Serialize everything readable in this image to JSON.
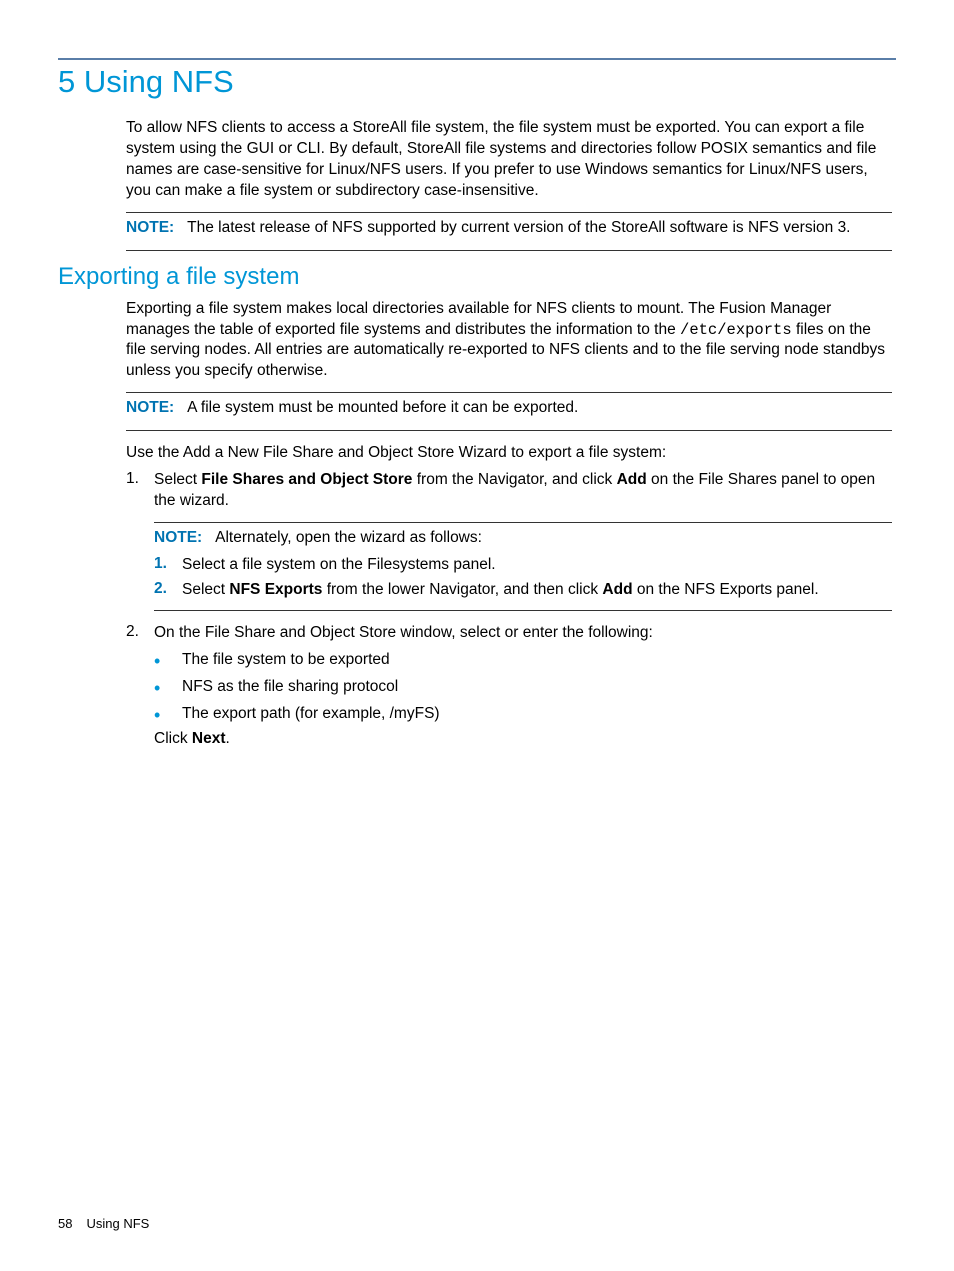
{
  "chapter": {
    "title": "5 Using NFS",
    "intro": "To allow NFS clients to access a StoreAll file system, the file system must be exported. You can export a file system using the GUI or CLI. By default, StoreAll file systems and directories follow POSIX semantics and file names are case-sensitive for Linux/NFS users. If you prefer to use Windows semantics for Linux/NFS users, you can make a file system or subdirectory case-insensitive."
  },
  "note1": {
    "label": "NOTE:",
    "text": "The latest release of NFS supported by current version of the StoreAll software is NFS version 3."
  },
  "section": {
    "title": "Exporting a file system",
    "intro_pre": "Exporting a file system makes local directories available for NFS clients to mount. The Fusion Manager manages the table of exported file systems and distributes the information to the ",
    "intro_code": "/etc/exports",
    "intro_post": " files on the file serving nodes. All entries are automatically re-exported to NFS clients and to the file serving node standbys unless you specify otherwise."
  },
  "note2": {
    "label": "NOTE:",
    "text": "A file system must be mounted before it can be exported."
  },
  "wizard_line": "Use the Add a New File Share and Object Store Wizard to export a file system:",
  "step1": {
    "num": "1.",
    "pre": "Select ",
    "bold1": "File Shares and Object Store",
    "mid": " from the Navigator, and click ",
    "bold2": "Add",
    "post": " on the File Shares panel to open the wizard."
  },
  "step1_note": {
    "label": "NOTE:",
    "text": "Alternately, open the wizard as follows:",
    "sub1": {
      "num": "1.",
      "text": "Select a file system on the Filesystems panel."
    },
    "sub2": {
      "num": "2.",
      "pre": "Select ",
      "bold1": "NFS Exports",
      "mid": " from the lower Navigator, and then click ",
      "bold2": "Add",
      "post": " on the NFS Exports panel."
    }
  },
  "step2": {
    "num": "2.",
    "text": "On the File Share and Object Store window, select or enter the following:",
    "bullets": [
      "The file system to be exported",
      "NFS as the file sharing protocol",
      "The export path (for example, /myFS)"
    ],
    "click_pre": "Click ",
    "click_bold": "Next",
    "click_post": "."
  },
  "footer": {
    "page": "58",
    "title": "Using NFS"
  }
}
